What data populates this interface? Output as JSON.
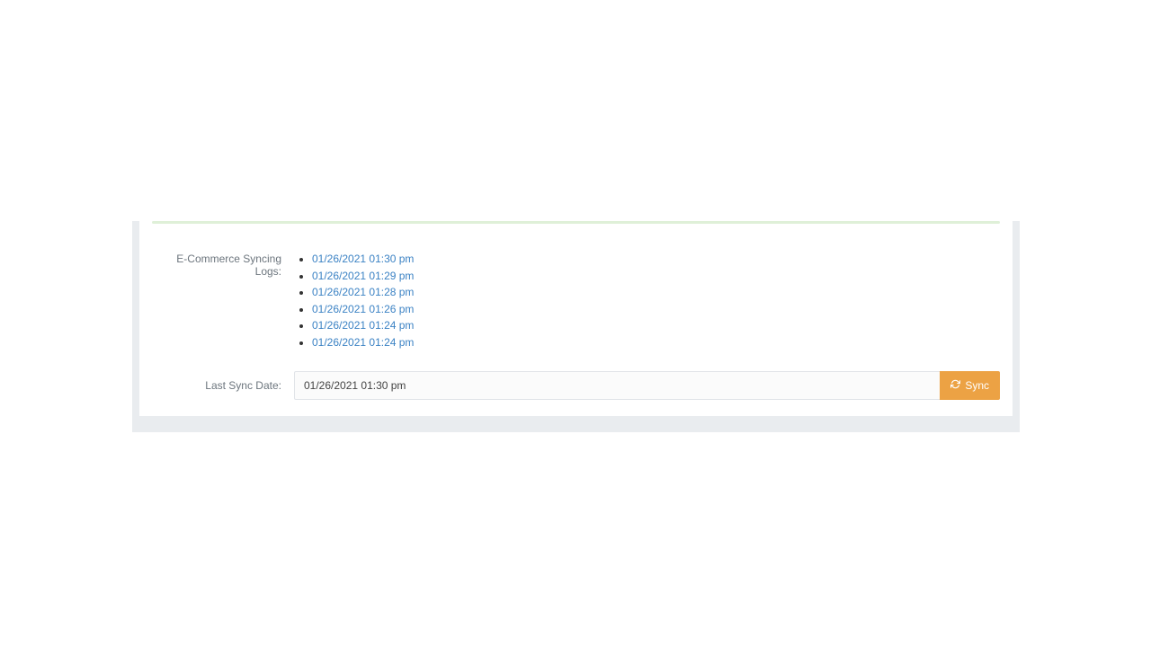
{
  "labels": {
    "syncing_logs": "E-Commerce Syncing Logs:",
    "last_sync_date": "Last Sync Date:"
  },
  "logs": [
    "01/26/2021 01:30 pm",
    "01/26/2021 01:29 pm",
    "01/26/2021 01:28 pm",
    "01/26/2021 01:26 pm",
    "01/26/2021 01:24 pm",
    "01/26/2021 01:24 pm"
  ],
  "last_sync": {
    "value": "01/26/2021 01:30 pm",
    "button_label": "Sync"
  },
  "colors": {
    "link": "#3b82c4",
    "button_bg": "#eca244",
    "panel_bg": "#e9ecef",
    "top_strip": "#dff0d8"
  }
}
